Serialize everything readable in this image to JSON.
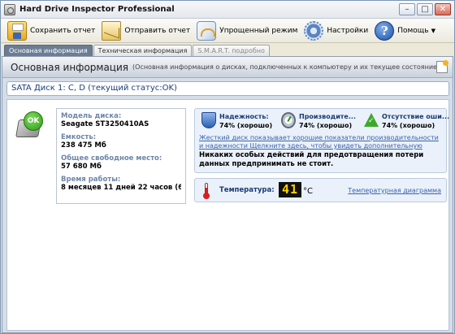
{
  "window": {
    "title": "Hard Drive Inspector Professional",
    "min": "–",
    "max": "□",
    "close": "✕"
  },
  "toolbar": {
    "save": "Сохранить отчет",
    "send": "Отправить отчет",
    "simple": "Упрощенный режим",
    "settings": "Настройки",
    "help": "Помощь",
    "help_caret": "▼",
    "help_glyph": "?"
  },
  "tabs": [
    {
      "label": "Основная информация",
      "active": true
    },
    {
      "label": "Техническая информация",
      "active": false
    },
    {
      "label": "S.M.A.R.T. подробно",
      "active": false
    }
  ],
  "header": {
    "title": "Основная информация",
    "subtitle": "(Основная информация о дисках, подключенных к компьютеру и  их текущее состояние)"
  },
  "disk": {
    "heading": "SATA Диск 1: C, D (текущий статус:OK)",
    "badge": "OK",
    "model_label": "Модель диска:",
    "model": "Seagate ST3250410AS",
    "capacity_label": "Емкость:",
    "capacity": "238 475 Мб",
    "free_label": "Общее свободное место:",
    "free": "57 680 Мб",
    "uptime_label": "Время работы:",
    "uptime": "8 месяцев 11 дней 22 часов (6 ..."
  },
  "status": {
    "reliability_label": "Надежность:",
    "reliability_value": "74% (хорошо)",
    "performance_label": "Производите...",
    "performance_value": "74% (хорошо)",
    "errors_label": "Отсутствие оши...",
    "errors_value": "74% (хорошо)",
    "link_text": "Жесткий диск показывает хорошие показатели производительности и надежности Щелкните здесь, чтобы увидеть дополнительную информацию о S.M.A.R.T.",
    "note": "Никаких особых действий для предотвращения потери данных предпринимать не стоит."
  },
  "temperature": {
    "label": "Температура:",
    "value": "41",
    "unit": "°С",
    "link": "Температурная диаграмма"
  }
}
